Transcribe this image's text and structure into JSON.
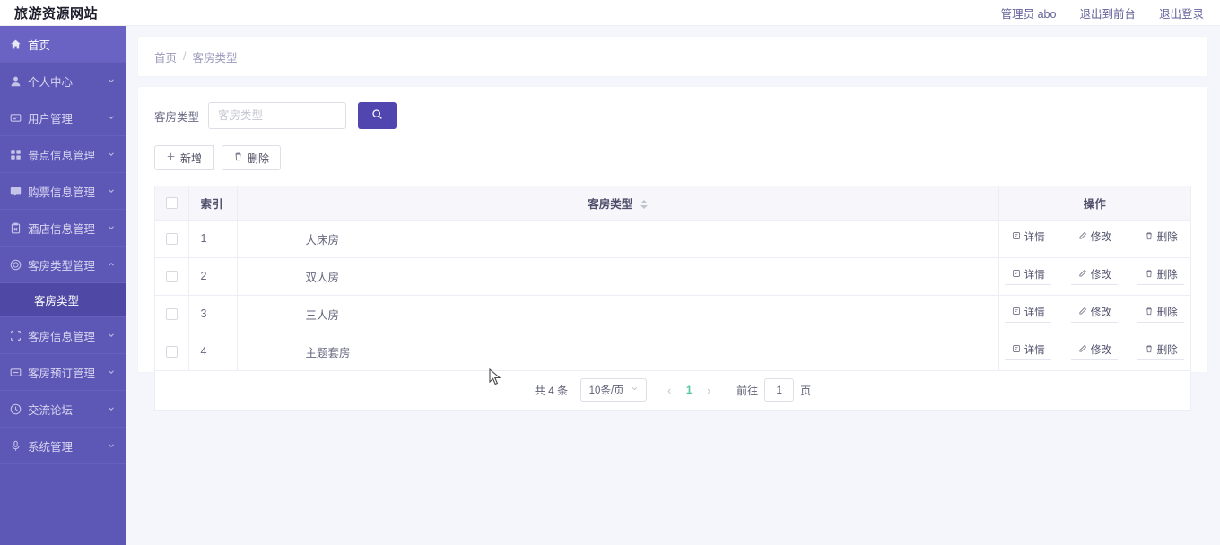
{
  "header": {
    "brand": "旅游资源网站",
    "links": [
      {
        "label": "管理员 abo",
        "name": "admin-user"
      },
      {
        "label": "退出到前台",
        "name": "exit-to-frontend"
      },
      {
        "label": "退出登录",
        "name": "logout"
      }
    ]
  },
  "sidebar": {
    "items": [
      {
        "label": "首页",
        "icon": "home-icon",
        "expandable": false,
        "active": true
      },
      {
        "label": "个人中心",
        "icon": "user-icon",
        "expandable": true,
        "active": false
      },
      {
        "label": "用户管理",
        "icon": "message-icon",
        "expandable": true,
        "active": false
      },
      {
        "label": "景点信息管理",
        "icon": "grid-icon",
        "expandable": true,
        "active": false
      },
      {
        "label": "购票信息管理",
        "icon": "chat-icon",
        "expandable": true,
        "active": false
      },
      {
        "label": "酒店信息管理",
        "icon": "clipboard-icon",
        "expandable": true,
        "active": false
      },
      {
        "label": "客房类型管理",
        "icon": "circle-icon",
        "expandable": true,
        "expanded": true,
        "active": false
      },
      {
        "label": "客房信息管理",
        "icon": "crop-icon",
        "expandable": true,
        "active": false
      },
      {
        "label": "客房预订管理",
        "icon": "card-icon",
        "expandable": true,
        "active": false
      },
      {
        "label": "交流论坛",
        "icon": "clock-icon",
        "expandable": true,
        "active": false
      },
      {
        "label": "系统管理",
        "icon": "mic-icon",
        "expandable": true,
        "active": false
      }
    ],
    "submenu": {
      "label": "客房类型",
      "parent_index": 6
    }
  },
  "breadcrumb": {
    "home": "首页",
    "separator": "/",
    "current": "客房类型"
  },
  "filter": {
    "label": "客房类型",
    "placeholder": "客房类型",
    "value": "",
    "search_icon": "search-icon"
  },
  "toolbar": {
    "add_label": "新增",
    "add_icon": "plus-icon",
    "delete_label": "删除",
    "delete_icon": "trash-icon"
  },
  "table": {
    "columns": {
      "index": "索引",
      "type": "客房类型",
      "ops": "操作"
    },
    "rows": [
      {
        "index": "1",
        "type": "大床房"
      },
      {
        "index": "2",
        "type": "双人房"
      },
      {
        "index": "3",
        "type": "三人房"
      },
      {
        "index": "4",
        "type": "主题套房"
      }
    ],
    "ops": {
      "detail": "详情",
      "edit": "修改",
      "delete": "删除"
    }
  },
  "pagination": {
    "total": "共 4 条",
    "page_size": "10条/页",
    "prev": "‹",
    "next": "›",
    "current_page": "1",
    "jump_prefix": "前往",
    "jump_value": "1",
    "jump_suffix": "页"
  },
  "colors": {
    "sidebar": "#5d57b6",
    "sidebar_active": "#6a63c4",
    "submenu_active": "#4f49a5",
    "primary": "#5146b0",
    "page_bg": "#f5f6fb",
    "pager_active": "#56c8a8"
  }
}
